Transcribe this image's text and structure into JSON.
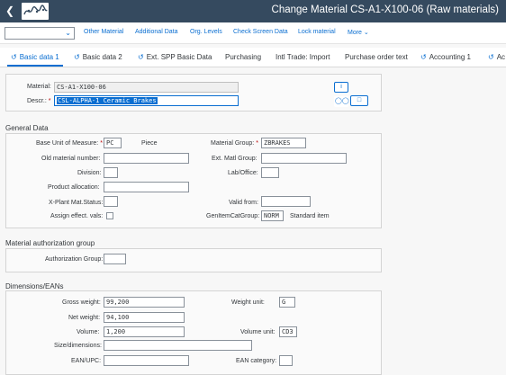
{
  "shell": {
    "title": "Change Material CS-A1-X100-06 (Raw materials)"
  },
  "toolbar": {
    "select_value": "",
    "items": [
      "Other Material",
      "Additional Data",
      "Org. Levels",
      "Check Screen Data",
      "Lock material",
      "More"
    ]
  },
  "tabs": [
    "Basic data 1",
    "Basic data 2",
    "Ext. SPP Basic Data",
    "Purchasing",
    "Intl Trade: Import",
    "Purchase order text",
    "Accounting 1",
    "Ac"
  ],
  "header": {
    "material_label": "Material:",
    "material_value": "CS-A1-X100-06",
    "descr_label": "Descr.:",
    "descr_value": "CSL-ALPHA-1 Ceramic Brakes"
  },
  "general": {
    "title": "General Data",
    "base_uom_label": "Base Unit of Measure:",
    "base_uom_value": "PC",
    "base_uom_text": "Piece",
    "material_group_label": "Material Group:",
    "material_group_value": "ZBRAKES",
    "old_material_label": "Old material number:",
    "old_material_value": "",
    "ext_matl_group_label": "Ext. Matl Group:",
    "ext_matl_group_value": "",
    "division_label": "Division:",
    "division_value": "",
    "lab_office_label": "Lab/Office:",
    "lab_office_value": "",
    "product_alloc_label": "Product allocation:",
    "product_alloc_value": "",
    "xplant_label": "X-Plant Mat.Status:",
    "xplant_value": "",
    "valid_from_label": "Valid from:",
    "valid_from_value": "",
    "assign_label": "Assign effect. vals:",
    "genitem_label": "GenItemCatGroup:",
    "genitem_value": "NORM",
    "genitem_text": "Standard item"
  },
  "auth": {
    "title": "Material authorization group",
    "auth_group_label": "Authorization Group:",
    "auth_group_value": ""
  },
  "dims": {
    "title": "Dimensions/EANs",
    "gross_label": "Gross weight:",
    "gross_value": "99,200",
    "weight_unit_label": "Weight unit:",
    "weight_unit_value": "G",
    "net_label": "Net weight:",
    "net_value": "94,100",
    "volume_label": "Volume:",
    "volume_value": "1,200",
    "volume_unit_label": "Volume unit:",
    "volume_unit_value": "CD3",
    "size_label": "Size/dimensions:",
    "size_value": "",
    "ean_label": "EAN/UPC:",
    "ean_value": "",
    "ean_cat_label": "EAN category:",
    "ean_cat_value": ""
  }
}
